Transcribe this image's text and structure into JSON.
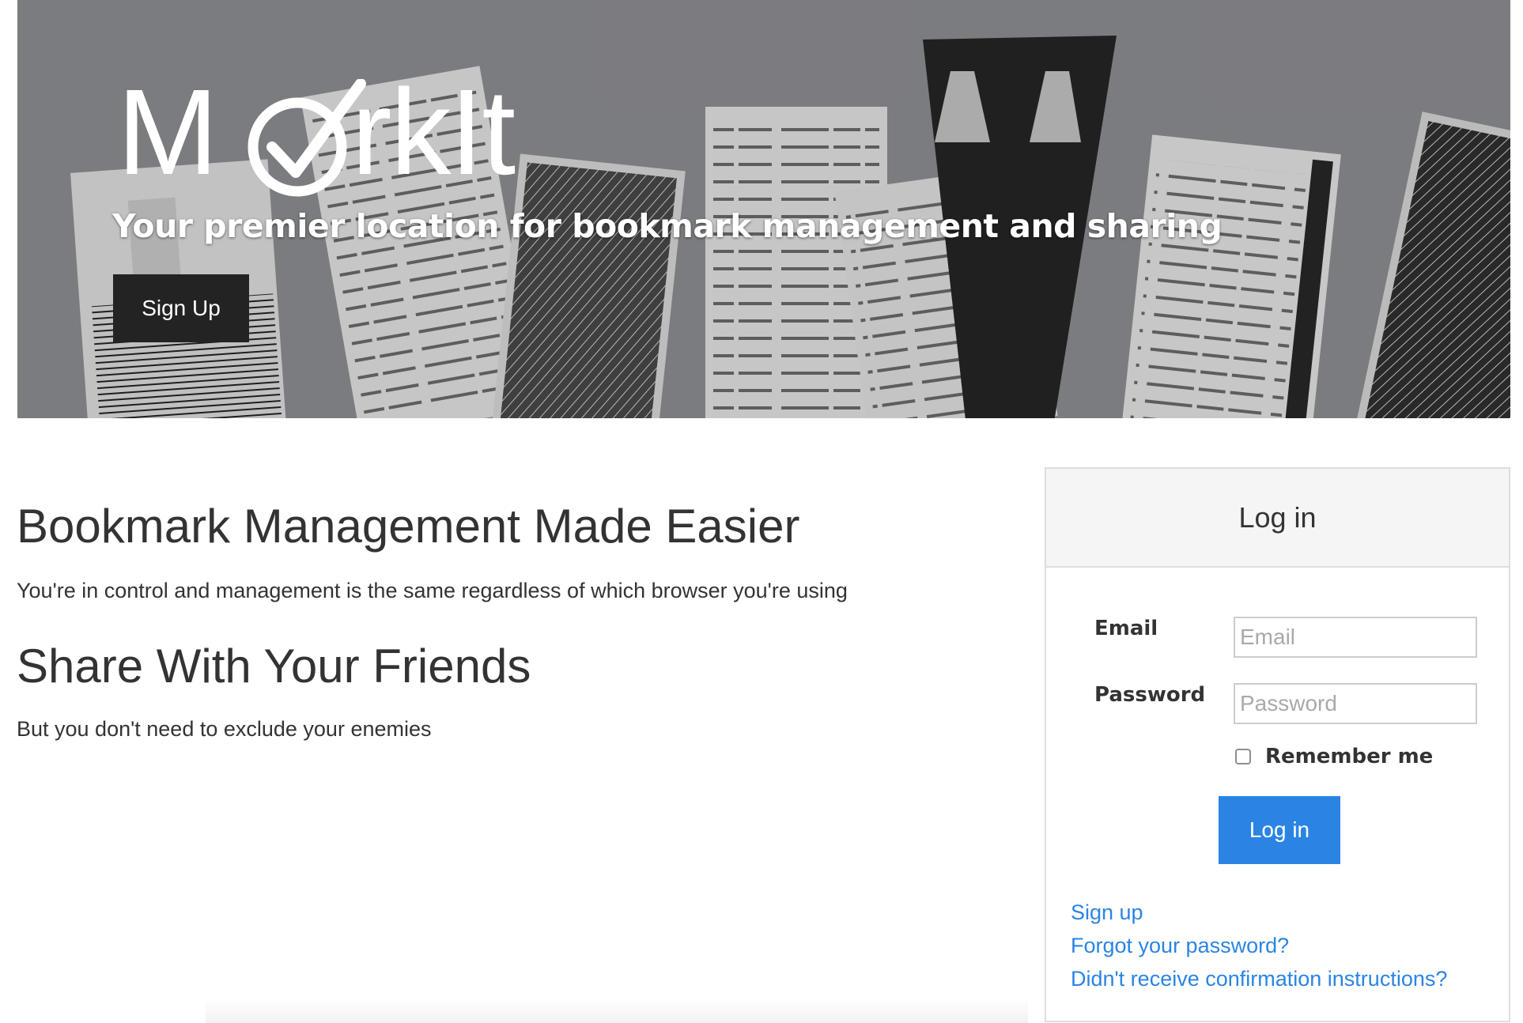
{
  "hero": {
    "logo_text": "MarkIt",
    "logo_before_check": "M",
    "logo_after_check": "rkIt",
    "tagline": "Your premier location for bookmark management and sharing",
    "signup_button": "Sign Up"
  },
  "features": [
    {
      "heading": "Bookmark Management Made Easier",
      "text": "You're in control and management is the same regardless of which browser you're using"
    },
    {
      "heading": "Share With Your Friends",
      "text": "But you don't need to exclude your enemies"
    }
  ],
  "login": {
    "title": "Log in",
    "email_label": "Email",
    "email_value": "",
    "email_placeholder": "Email",
    "password_label": "Password",
    "password_value": "",
    "password_placeholder": "Password",
    "remember_label": "Remember me",
    "remember_checked": false,
    "submit_label": "Log in",
    "links": {
      "signup": "Sign up",
      "forgot": "Forgot your password?",
      "confirm": "Didn't receive confirmation instructions?"
    }
  },
  "colors": {
    "accent": "#2b84e4",
    "dark_button": "#232323",
    "panel_header": "#f5f5f5",
    "border": "#dddddd"
  }
}
